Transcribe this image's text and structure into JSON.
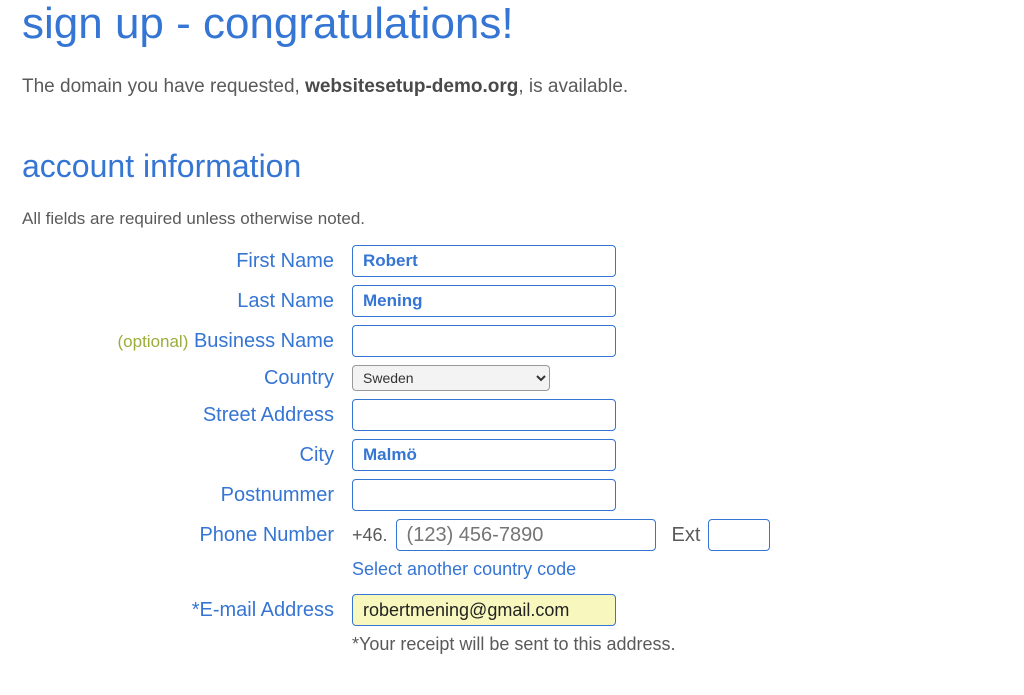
{
  "header": {
    "title": "sign up - congratulations!",
    "subtitle_pre": "The domain you have requested, ",
    "subtitle_domain": "websitesetup-demo.org",
    "subtitle_post": ", is available."
  },
  "section": {
    "heading": "account information",
    "required_note": "All fields are required unless otherwise noted."
  },
  "labels": {
    "first_name": "First Name",
    "last_name": "Last Name",
    "optional": "(optional)",
    "business_name": "Business Name",
    "country": "Country",
    "street": "Street Address",
    "city": "City",
    "postal": "Postnummer",
    "phone": "Phone Number",
    "ext": "Ext",
    "email": "E-mail Address"
  },
  "values": {
    "first_name": "Robert",
    "last_name": "Mening",
    "business_name": "",
    "country": "Sweden",
    "street": "",
    "city": "Malmö",
    "postal": "",
    "phone_prefix": "+46.",
    "phone_placeholder": "(123) 456-7890",
    "phone": "",
    "ext": "",
    "email": "robertmening@gmail.com"
  },
  "links": {
    "country_code": "Select another country code"
  },
  "hints": {
    "email": "*Your receipt will be sent to this address."
  }
}
